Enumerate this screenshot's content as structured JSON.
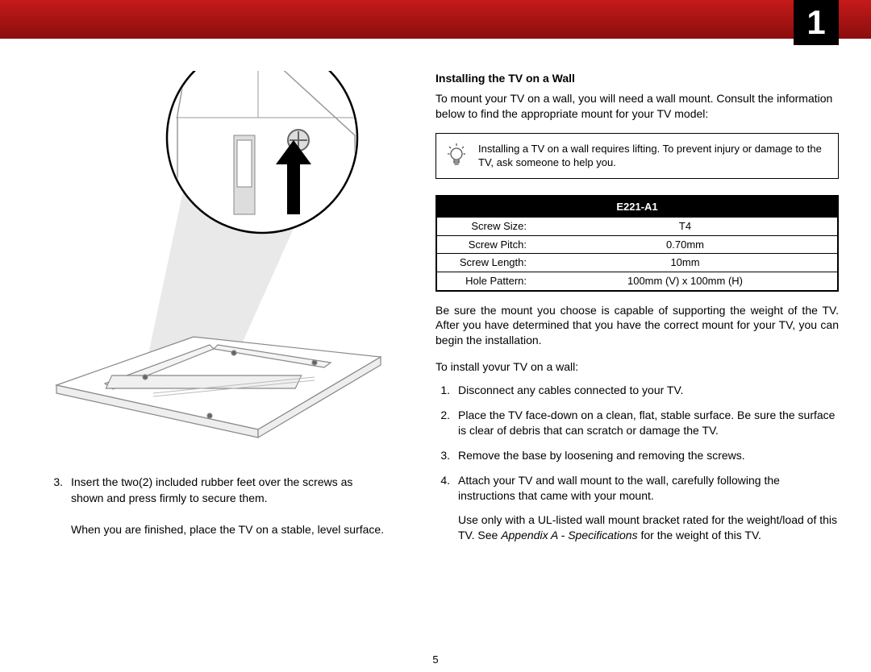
{
  "chapter": "1",
  "left": {
    "step_number": "3.",
    "step_text_1": "Insert the two(2) included rubber feet over the screws as shown and press firmly to secure them.",
    "step_text_2": "When you are finished, place the TV on a stable, level surface."
  },
  "right": {
    "heading": "Installing the TV on a Wall",
    "intro": "To mount your TV on a wall, you will need a wall mount. Consult the information below to find the appropriate mount for your TV model:",
    "callout": "Installing a TV on a wall requires lifting. To prevent injury or damage to the TV, ask someone to help you.",
    "table": {
      "model": "E221-A1",
      "rows": [
        {
          "label": "Screw Size:",
          "value": "T4"
        },
        {
          "label": "Screw Pitch:",
          "value": "0.70mm"
        },
        {
          "label": "Screw Length:",
          "value": "10mm"
        },
        {
          "label": "Hole Pattern:",
          "value": "100mm (V) x 100mm (H)"
        }
      ]
    },
    "after_table": "Be sure the mount you choose is capable of supporting the weight of the TV. After you have determined that you have the correct mount for your TV, you can begin the installation.",
    "steps_intro": "To install yovur TV on a wall:",
    "steps": [
      {
        "p1": "Disconnect any cables connected to your TV."
      },
      {
        "p1": "Place the TV face-down on a clean, flat, stable surface. Be sure the surface is clear of debris that can scratch or damage the TV."
      },
      {
        "p1": "Remove the base by loosening and removing the screws."
      },
      {
        "p1": "Attach your TV and wall mount to the wall, carefully following the instructions that came with your mount.",
        "p2a": "Use only with a UL-listed wall mount bracket rated for the weight/load of this TV. See ",
        "p2_ref": "Appendix A - Specifications",
        "p2b": " for the weight of this TV."
      }
    ]
  },
  "page_number": "5"
}
